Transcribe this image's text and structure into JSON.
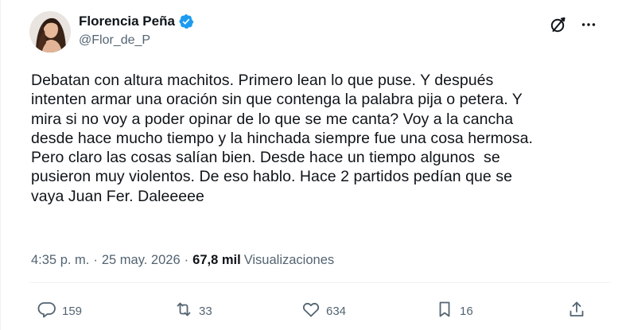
{
  "author": {
    "display_name": "Florencia Peña",
    "handle": "@Flor_de_P",
    "verified": true
  },
  "tweet": {
    "text": "Debatan con altura machitos. Primero lean lo que puse. Y después\nintenten armar una oración sin que contenga la palabra pija o petera. Y\nmira si no voy a poder opinar de lo que se me canta? Voy a la cancha\ndesde hace mucho tiempo y la hinchada siempre fue una cosa hermosa.\nPero claro las cosas salían bien. Desde hace un tiempo algunos  se\npusieron muy violentos. De eso hablo. Hace 2 partidos pedían que se\nvaya Juan Fer. Daleeeee",
    "time": "4:35 p. m.",
    "separator": "·",
    "date": "25 may. 2026",
    "views_count": "67,8 mil",
    "views_label": "Visualizaciones"
  },
  "actions": {
    "replies": "159",
    "reposts": "33",
    "likes": "634",
    "bookmarks": "16"
  },
  "icons": {
    "verified": "verified-badge-icon",
    "grok": "grok-icon",
    "more": "more-icon",
    "reply": "reply-icon",
    "repost": "repost-icon",
    "like": "like-icon",
    "bookmark": "bookmark-icon",
    "share": "share-icon"
  },
  "colors": {
    "text": "#0f1419",
    "muted": "#536471",
    "verified": "#1d9bf0",
    "divider": "#eff3f4"
  }
}
